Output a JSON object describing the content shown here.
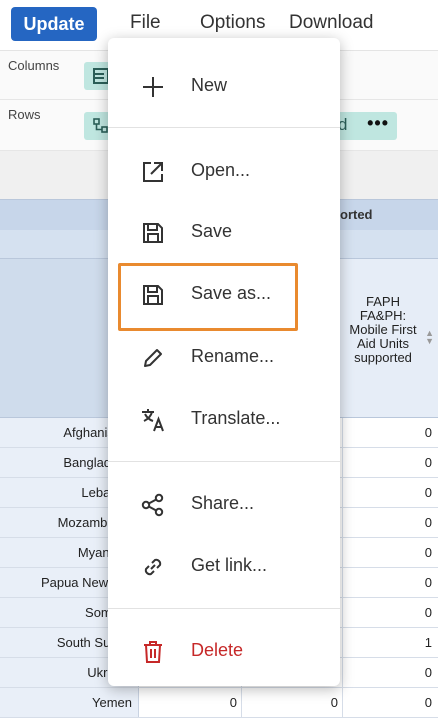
{
  "toolbar": {
    "update_label": "Update",
    "menu": {
      "file": "File",
      "options": "Options",
      "download": "Download"
    }
  },
  "layout": {
    "columns_label": "Columns",
    "rows_label": "Rows",
    "rows_chip_tail": "d",
    "more_glyph": "•••"
  },
  "table": {
    "header_group": "orted",
    "column_header": "FAPH FA&PH: Mobile First Aid Units supported",
    "rows": [
      {
        "name": "Afghanistan",
        "c3": "0"
      },
      {
        "name": "Bangladesh",
        "c3": "0"
      },
      {
        "name": "Lebanon",
        "c3": "0"
      },
      {
        "name": "Mozambique",
        "c3": "0"
      },
      {
        "name": "Myanmar",
        "c3": "0"
      },
      {
        "name": "Papua New Gui",
        "c3": "0"
      },
      {
        "name": "Somalia",
        "c3": "0"
      },
      {
        "name": "South Sudan",
        "c3": "1"
      },
      {
        "name": "Ukraine",
        "c3": "0"
      },
      {
        "name": "Yemen",
        "c1": "0",
        "c2": "0",
        "c3": "0"
      }
    ]
  },
  "file_menu": {
    "new": "New",
    "open": "Open...",
    "save": "Save",
    "save_as": "Save as...",
    "rename": "Rename...",
    "translate": "Translate...",
    "share": "Share...",
    "get_link": "Get link...",
    "delete": "Delete"
  },
  "colors": {
    "update_button": "#2566c2",
    "highlight": "#e98a2f",
    "delete": "#c62828",
    "chip": "#bfe6e0"
  }
}
